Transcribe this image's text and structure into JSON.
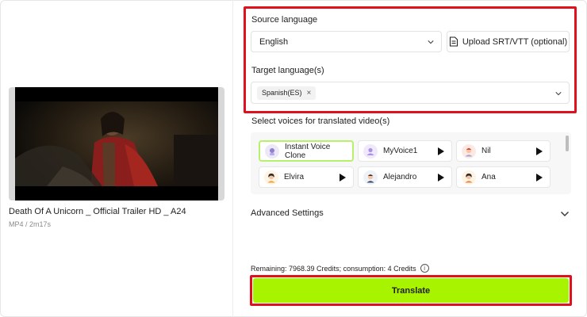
{
  "video": {
    "title": "Death Of A Unicorn _ Official Trailer HD _ A24",
    "meta": "MP4 / 2m17s"
  },
  "source_language": {
    "label": "Source language",
    "selected": "English"
  },
  "upload": {
    "label": "Upload SRT/VTT (optional)"
  },
  "target_language": {
    "label": "Target language(s)",
    "tags": [
      "Spanish(ES)"
    ]
  },
  "voices": {
    "label": "Select voices for translated video(s)",
    "items": [
      {
        "name": "Instant Voice Clone",
        "selected": true
      },
      {
        "name": "MyVoice1",
        "selected": false
      },
      {
        "name": "Nil",
        "selected": false
      },
      {
        "name": "Elvira",
        "selected": false
      },
      {
        "name": "Alejandro",
        "selected": false
      },
      {
        "name": "Ana",
        "selected": false
      }
    ]
  },
  "advanced": {
    "label": "Advanced Settings"
  },
  "credits": {
    "text": "Remaining: 7968.39 Credits; consumption: 4 Credits",
    "info_icon": "i"
  },
  "translate": {
    "label": "Translate"
  },
  "colors": {
    "accent": "#a7f300",
    "highlight": "#e0111d",
    "selected_border": "#b7f06a"
  }
}
